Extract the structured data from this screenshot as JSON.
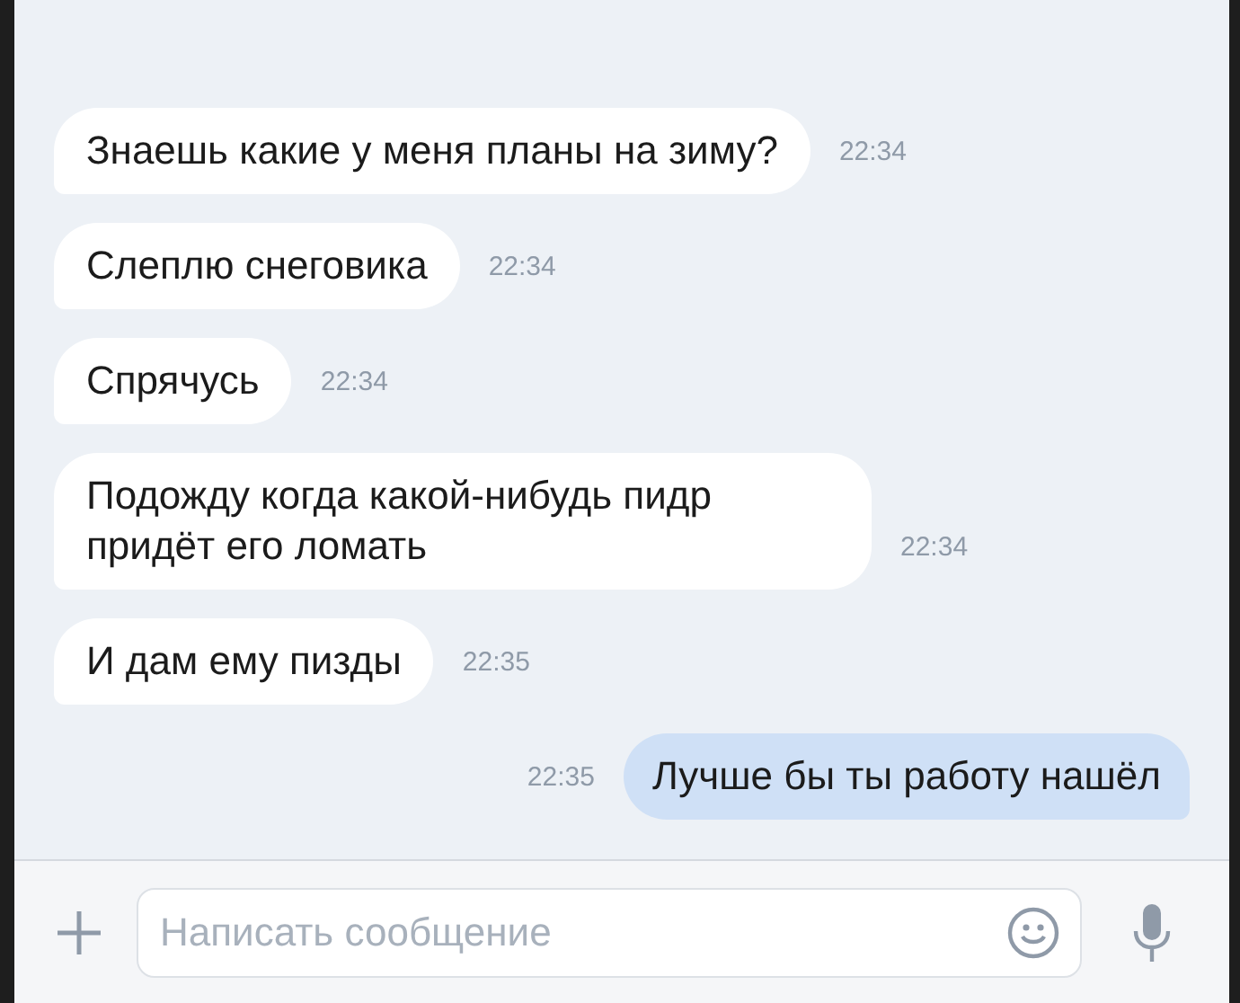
{
  "messages": [
    {
      "kind": "incoming",
      "text": "Знаешь какие у меня планы на зиму?",
      "time": "22:34"
    },
    {
      "kind": "incoming",
      "text": "Слеплю снеговика",
      "time": "22:34"
    },
    {
      "kind": "incoming",
      "text": "Спрячусь",
      "time": "22:34"
    },
    {
      "kind": "incoming",
      "text": "Подожду когда какой-нибудь пидр придёт его ломать",
      "time": "22:34"
    },
    {
      "kind": "incoming",
      "text": "И дам ему пизды",
      "time": "22:35"
    },
    {
      "kind": "outgoing",
      "text": "Лучше бы ты работу нашёл",
      "time": "22:35"
    }
  ],
  "composer": {
    "placeholder": "Написать сообщение"
  }
}
